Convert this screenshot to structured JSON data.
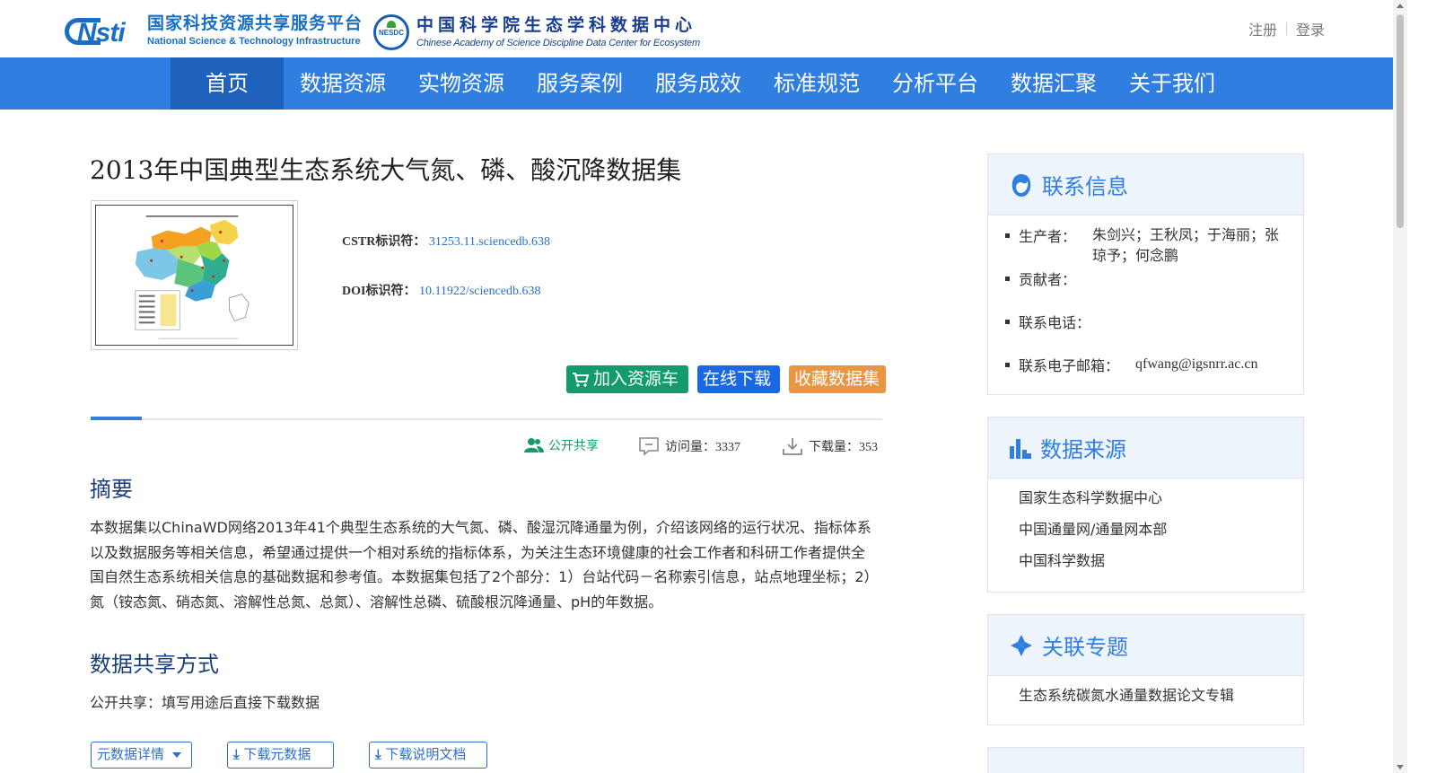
{
  "header": {
    "logo1_cn": "国家科技资源共享服务平台",
    "logo1_en": "National Science & Technology Infrastructure",
    "logo1_mark": "Nsti",
    "logo2_seal": "NESDC",
    "logo2_cn": "中国科学院生态学科数据中心",
    "logo2_en": "Chinese Academy of Science Discipline Data Center for Ecosystem",
    "register": "注册",
    "login": "登录"
  },
  "nav": {
    "items": [
      {
        "label": "首页"
      },
      {
        "label": "数据资源"
      },
      {
        "label": "实物资源"
      },
      {
        "label": "服务案例"
      },
      {
        "label": "服务成效"
      },
      {
        "label": "标准规范"
      },
      {
        "label": "分析平台"
      },
      {
        "label": "数据汇聚"
      },
      {
        "label": "关于我们"
      }
    ],
    "active_index": 0
  },
  "dataset": {
    "title": "2013年中国典型生态系统大气氮、磷、酸沉降数据集",
    "cstr_label": "CSTR标识符：",
    "cstr_value": "31253.11.sciencedb.638",
    "doi_label": "DOI标识符：",
    "doi_value": "10.11922/sciencedb.638"
  },
  "actions": {
    "add_cart": "加入资源车",
    "download": "在线下载",
    "favorite": "收藏数据集"
  },
  "stats": {
    "share": "公开共享",
    "visits": "访问量：3337",
    "downloads": "下载量：353"
  },
  "abstract": {
    "heading": "摘要",
    "text": "本数据集以ChinaWD网络2013年41个典型生态系统的大气氮、磷、酸湿沉降通量为例，介绍该网络的运行状况、指标体系以及数据服务等相关信息，希望通过提供一个相对系统的指标体系，为关注生态环境健康的社会工作者和科研工作者提供全国自然生态系统相关信息的基础数据和参考值。本数据集包括了2个部分：1）台站代码－名称索引信息，站点地理坐标；2）氮（铵态氮、硝态氮、溶解性总氮、总氮）、溶解性总磷、硫酸根沉降通量、pH的年数据。"
  },
  "sharing": {
    "heading": "数据共享方式",
    "text": "公开共享：填写用途后直接下载数据"
  },
  "bottom_buttons": {
    "meta_detail": "元数据详情",
    "download_meta": "下载元数据",
    "download_doc": "下载说明文档"
  },
  "sidebar": {
    "contact": {
      "title": "联系信息",
      "producer_label": "生产者：",
      "producer_value": "朱剑兴；王秋凤；于海丽；张琼予；何念鹏",
      "contributor_label": "贡献者：",
      "phone_label": "联系电话：",
      "email_label": "联系电子邮箱：",
      "email_value": "qfwang@igsnrr.ac.cn"
    },
    "sources": {
      "title": "数据来源",
      "items": [
        "国家生态科学数据中心",
        "中国通量网/通量网本部",
        "中国科学数据"
      ]
    },
    "topics": {
      "title": "关联专题",
      "items": [
        "生态系统碳氮水通量数据论文专辑"
      ]
    }
  },
  "colors": {
    "nav_bg": "#2f7ee0",
    "nav_active": "#1e62bd",
    "brand_blue": "#1a6fc4",
    "btn_green": "#149b6d",
    "btn_blue": "#1b68e6",
    "btn_orange": "#ea9540",
    "sidebar_head_bg": "#eef4fc"
  },
  "icons": {
    "cart": "cart-icon",
    "share": "people-icon",
    "visits": "comment-icon",
    "downloads": "download-icon",
    "contact": "person-icon",
    "sources": "bar-chart-icon",
    "topics": "compass-icon"
  }
}
